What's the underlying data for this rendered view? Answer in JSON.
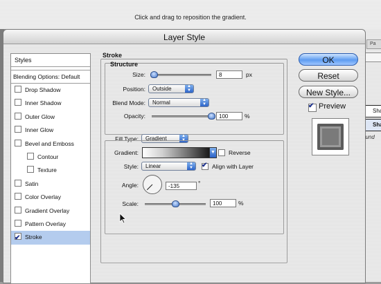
{
  "app": {
    "hint": "Click and drag to reposition the gradient.",
    "right_panel": {
      "tab": "Pa",
      "layer1": "Sha",
      "layer2": "Sha",
      "footer": "ound"
    }
  },
  "dialog": {
    "title": "Layer Style",
    "styles_header": "Styles",
    "blending": "Blending Options: Default",
    "styles": [
      {
        "label": "Drop Shadow",
        "checked": false,
        "sub": false,
        "selected": false
      },
      {
        "label": "Inner Shadow",
        "checked": false,
        "sub": false,
        "selected": false
      },
      {
        "label": "Outer Glow",
        "checked": false,
        "sub": false,
        "selected": false
      },
      {
        "label": "Inner Glow",
        "checked": false,
        "sub": false,
        "selected": false
      },
      {
        "label": "Bevel and Emboss",
        "checked": false,
        "sub": false,
        "selected": false
      },
      {
        "label": "Contour",
        "checked": false,
        "sub": true,
        "selected": false
      },
      {
        "label": "Texture",
        "checked": false,
        "sub": true,
        "selected": false
      },
      {
        "label": "Satin",
        "checked": false,
        "sub": false,
        "selected": false
      },
      {
        "label": "Color Overlay",
        "checked": false,
        "sub": false,
        "selected": false
      },
      {
        "label": "Gradient Overlay",
        "checked": false,
        "sub": false,
        "selected": false
      },
      {
        "label": "Pattern Overlay",
        "checked": false,
        "sub": false,
        "selected": false
      },
      {
        "label": "Stroke",
        "checked": true,
        "sub": false,
        "selected": true
      }
    ],
    "stroke": {
      "section": "Stroke",
      "structure": "Structure",
      "size_label": "Size:",
      "size_value": "8",
      "size_unit": "px",
      "size_slider_fraction": 0.04,
      "position_label": "Position:",
      "position_value": "Outside",
      "blend_label": "Blend Mode:",
      "blend_value": "Normal",
      "opacity_label": "Opacity:",
      "opacity_value": "100",
      "opacity_unit": "%",
      "opacity_slider_fraction": 1.0,
      "fill_type_label": "Fill Type:",
      "fill_type_value": "Gradient",
      "gradient_label": "Gradient:",
      "reverse_label": "Reverse",
      "reverse_checked": false,
      "style_label": "Style:",
      "style_value": "Linear",
      "align_label": "Align with Layer",
      "align_checked": true,
      "angle_label": "Angle:",
      "angle_value": "-135",
      "angle_unit": "°",
      "scale_label": "Scale:",
      "scale_value": "100",
      "scale_unit": "%",
      "scale_slider_fraction": 0.5
    },
    "buttons": {
      "ok": "OK",
      "reset": "Reset",
      "new_style": "New Style...",
      "preview": "Preview"
    },
    "preview_checked": true
  },
  "colors": {
    "accent": "#3f74c9",
    "selection": "#b4ccee"
  }
}
